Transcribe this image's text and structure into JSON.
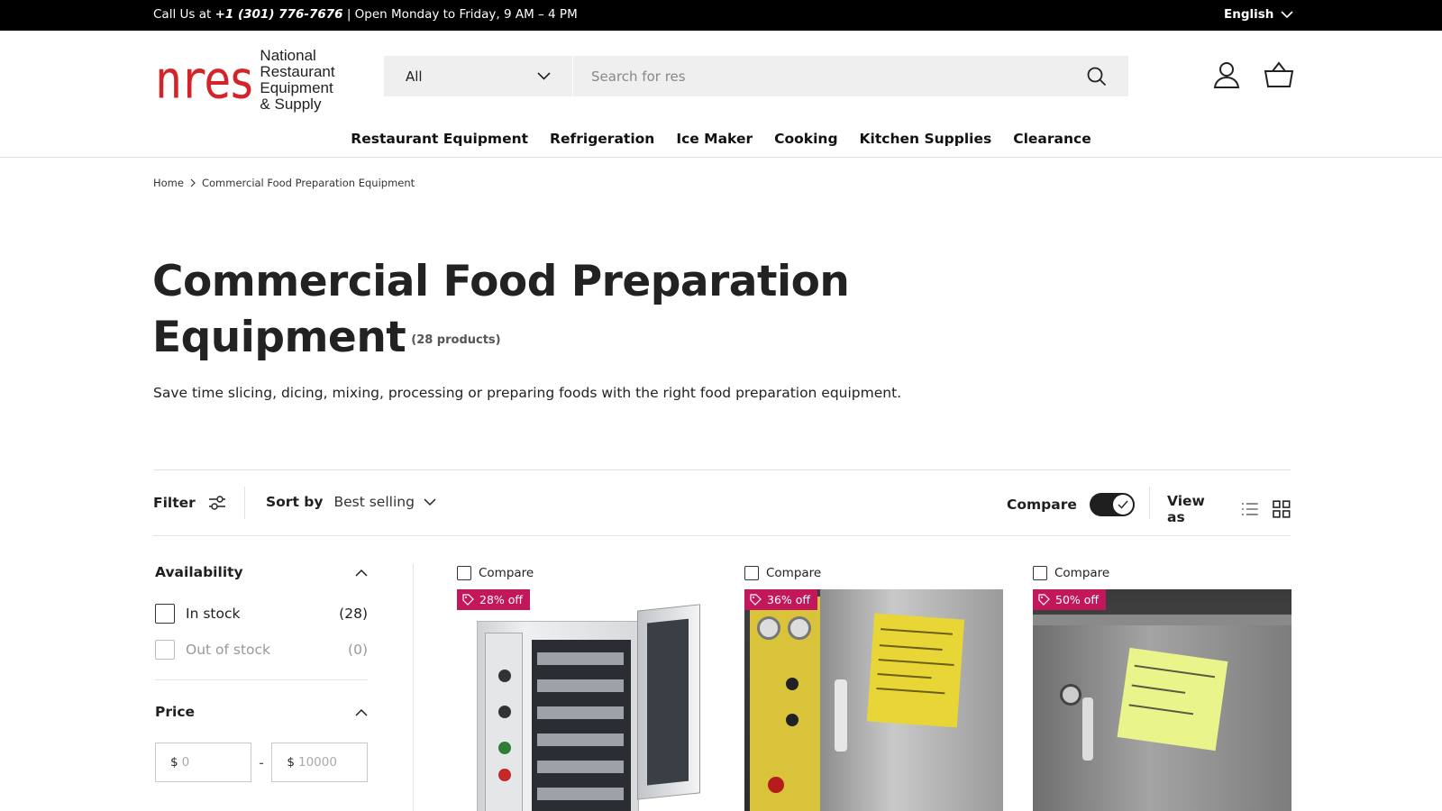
{
  "topbar": {
    "call_prefix": "Call Us at",
    "phone": "+1 (301) 776-7676",
    "hours": "| Open Monday to Friday, 9 AM – 4 PM",
    "language": "English"
  },
  "logo": {
    "mark": "nres",
    "wordmark": "National\nRestaurant\nEquipment\n& Supply"
  },
  "search": {
    "category_selected": "All",
    "placeholder": "Search for res",
    "value": ""
  },
  "nav": {
    "items": [
      "Restaurant Equipment",
      "Refrigeration",
      "Ice Maker",
      "Cooking",
      "Kitchen Supplies",
      "Clearance"
    ]
  },
  "breadcrumb": {
    "home": "Home",
    "current": "Commercial Food Preparation Equipment"
  },
  "collection": {
    "title": "Commercial Food Preparation Equipment",
    "count": "(28 products)",
    "description": "Save time slicing, dicing, mixing, processing or preparing foods with the right food preparation equipment."
  },
  "toolbar": {
    "filter_label": "Filter",
    "sort_label": "Sort by",
    "sort_value": "Best selling",
    "compare_label": "Compare",
    "compare_on": true,
    "view_label": "View as"
  },
  "facets": {
    "availability": {
      "title": "Availability",
      "options": [
        {
          "label": "In stock",
          "count": "(28)"
        },
        {
          "label": "Out of stock",
          "count": "(0)"
        }
      ]
    },
    "price": {
      "title": "Price",
      "currency": "$",
      "min_placeholder": "0",
      "max_placeholder": "10000",
      "separator": "-"
    }
  },
  "products": [
    {
      "compare_label": "Compare",
      "badge": "28% off"
    },
    {
      "compare_label": "Compare",
      "badge": "36% off"
    },
    {
      "compare_label": "Compare",
      "badge": "50% off"
    }
  ],
  "colors": {
    "topbar_bg": "#000000",
    "brand_red": "#d4242a",
    "sale_badge": "#c2185b",
    "search_bg": "#efefef",
    "text": "#1f1f1f"
  }
}
